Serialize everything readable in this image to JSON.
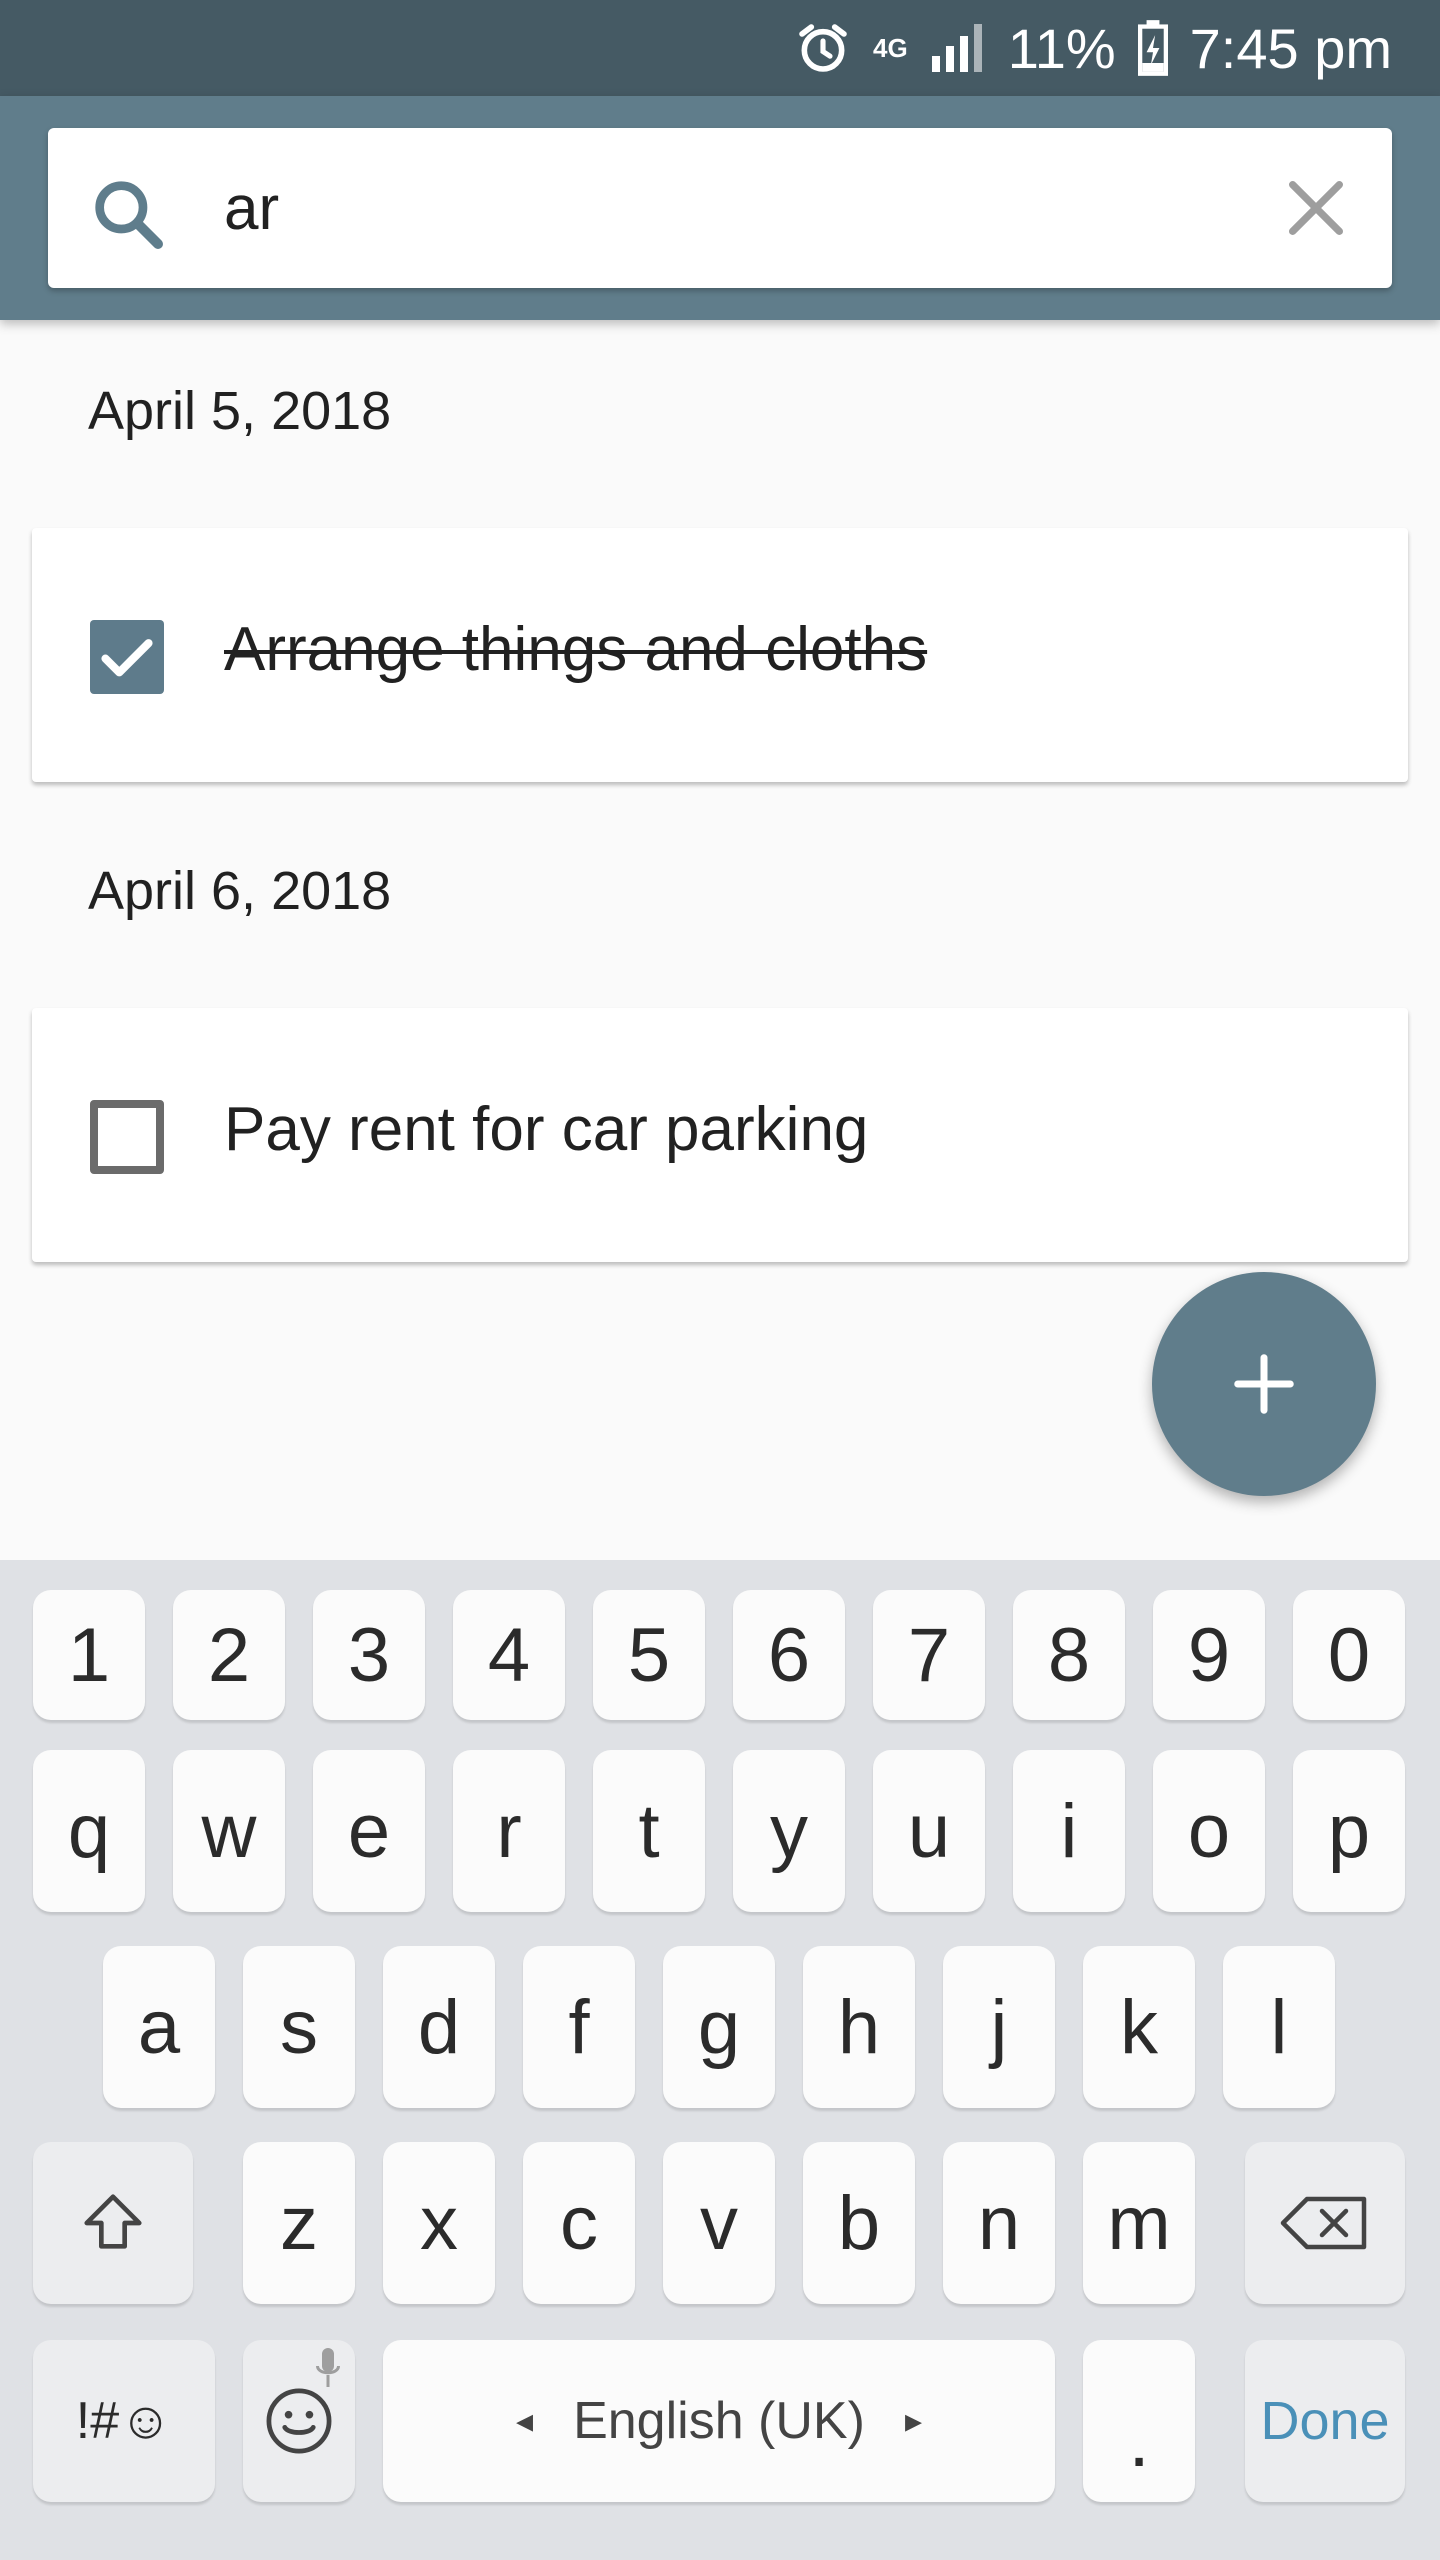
{
  "status_bar": {
    "network": "4G",
    "battery": "11%",
    "time": "7:45 pm"
  },
  "search": {
    "value": "ar",
    "icon": "search-icon",
    "clear_icon": "close-icon"
  },
  "groups": [
    {
      "date": "April 5, 2018",
      "tasks": [
        {
          "text": "Arrange things and cloths",
          "checked": true
        }
      ]
    },
    {
      "date": "April 6, 2018",
      "tasks": [
        {
          "text": "Pay rent for car parking",
          "checked": false
        }
      ]
    }
  ],
  "fab": {
    "label": "+"
  },
  "keyboard": {
    "number_row": [
      "1",
      "2",
      "3",
      "4",
      "5",
      "6",
      "7",
      "8",
      "9",
      "0"
    ],
    "row1": [
      "q",
      "w",
      "e",
      "r",
      "t",
      "y",
      "u",
      "i",
      "o",
      "p"
    ],
    "row2": [
      "a",
      "s",
      "d",
      "f",
      "g",
      "h",
      "j",
      "k",
      "l"
    ],
    "row3": [
      "z",
      "x",
      "c",
      "v",
      "b",
      "n",
      "m"
    ],
    "symbols_key": "!#☺",
    "space_label": "English (UK)",
    "period_key": ".",
    "done_key": "Done"
  },
  "colors": {
    "status_bar": "#455a64",
    "toolbar": "#607d8b",
    "accent": "#607d8b",
    "done_key_text": "#4a90b8"
  }
}
